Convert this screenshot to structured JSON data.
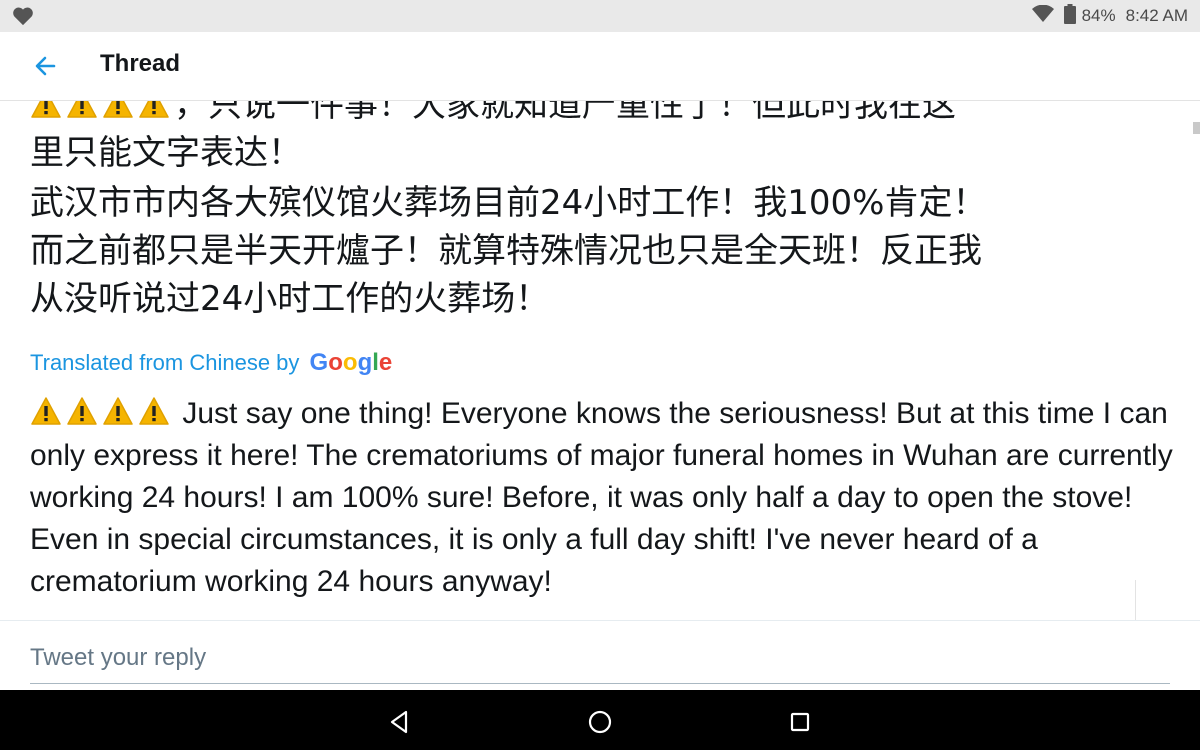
{
  "status_bar": {
    "battery": "84%",
    "time": "8:42 AM",
    "icons": [
      "heart-icon",
      "wifi-icon",
      "battery-icon"
    ]
  },
  "header": {
    "title": "Thread",
    "back_icon": "back-arrow-icon"
  },
  "tweet": {
    "chinese_lines": [
      "，只说一件事！大家就知道严重性了！但此时我在这",
      "里只能文字表达！",
      "武汉市市内各大殡仪馆火葬场目前24小时工作！我100%肯定！",
      "而之前都只是半天开爐子！就算特殊情况也只是全天班！反正我",
      "从没听说过24小时工作的火葬场！"
    ],
    "translated_by": "Translated from Chinese by",
    "translator": "Google",
    "translation": "Just say one thing! Everyone knows the seriousness! But at this time I can only express it here! The crematoriums of major funeral homes in Wuhan are currently working 24 hours! I am 100% sure! Before, it was only half a day to open the stove! Even in special circumstances, it is only a full day shift! I've never heard of a crematorium working 24 hours anyway!"
  },
  "reply": {
    "placeholder": "Tweet your reply",
    "value": ""
  },
  "nav_bar": {
    "icons": [
      "nav-back-icon",
      "nav-home-icon",
      "nav-recents-icon"
    ]
  },
  "colors": {
    "accent": "#1b95e0",
    "text": "#14171a",
    "muted": "#657786",
    "warning": "#f5b400",
    "status_bar_bg": "#e9e9e9",
    "nav_bar_bg": "#000000"
  }
}
